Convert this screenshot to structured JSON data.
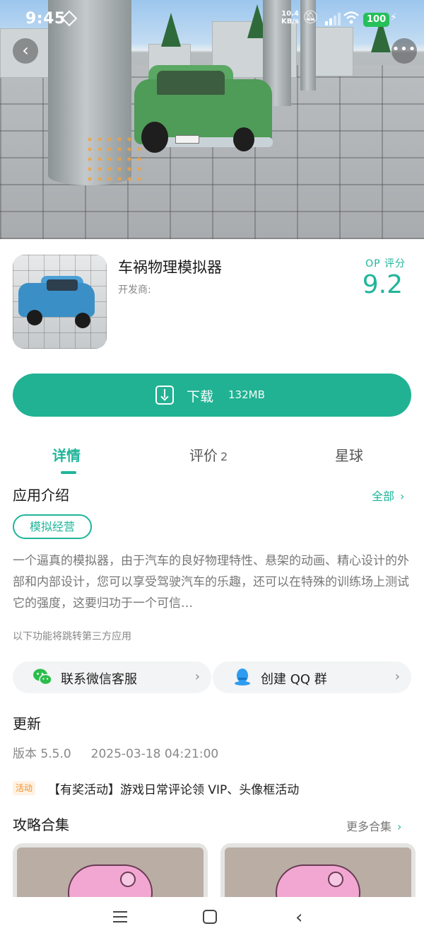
{
  "status_bar": {
    "time": "9:45",
    "speed_value": "10.4",
    "speed_unit": "KB/s",
    "battery": "100",
    "icons": [
      "vpn-icon",
      "mute-bell-icon",
      "signal-icon",
      "wifi-icon",
      "battery-icon",
      "charging-icon"
    ]
  },
  "hero": {
    "back_icon": "chevron-left-icon",
    "more_icon": "more-horizontal-icon"
  },
  "app": {
    "title": "车祸物理模拟器",
    "developer_label": "开发商:",
    "rating_label": "OP 评分",
    "rating_value": "9.2"
  },
  "download": {
    "label": "下载",
    "size": "132MB",
    "icon": "download-icon"
  },
  "tabs": [
    {
      "label": "详情",
      "active": true
    },
    {
      "label": "评价",
      "count": "2",
      "active": false
    },
    {
      "label": "星球",
      "active": false
    }
  ],
  "intro": {
    "title": "应用介绍",
    "link": "全部",
    "tag": "模拟经营",
    "description": "一个逼真的模拟器，由于汽车的良好物理特性、悬架的动画、精心设计的外部和内部设计，您可以享受驾驶汽车的乐趣，还可以在特殊的训练场上测试它的强度，这要归功于一个可信…"
  },
  "third_party_note": "以下功能将跳转第三方应用",
  "services": [
    {
      "label": "联系微信客服",
      "icon": "wechat-icon"
    },
    {
      "label": "创建 QQ 群",
      "icon": "qq-icon"
    }
  ],
  "update": {
    "title": "更新",
    "version": "版本 5.5.0",
    "date": "2025-03-18 04:21:00",
    "activity_badge": "活动",
    "activity_text": "【有奖活动】游戏日常评论领 VIP、头像框活动"
  },
  "guides": {
    "title": "攻略合集",
    "link": "更多合集"
  },
  "colors": {
    "accent": "#21b294",
    "activity": "#ef8f2b",
    "battery": "#25c05a"
  },
  "nav": {
    "icons": [
      "menu-icon",
      "home-icon",
      "back-icon"
    ]
  }
}
